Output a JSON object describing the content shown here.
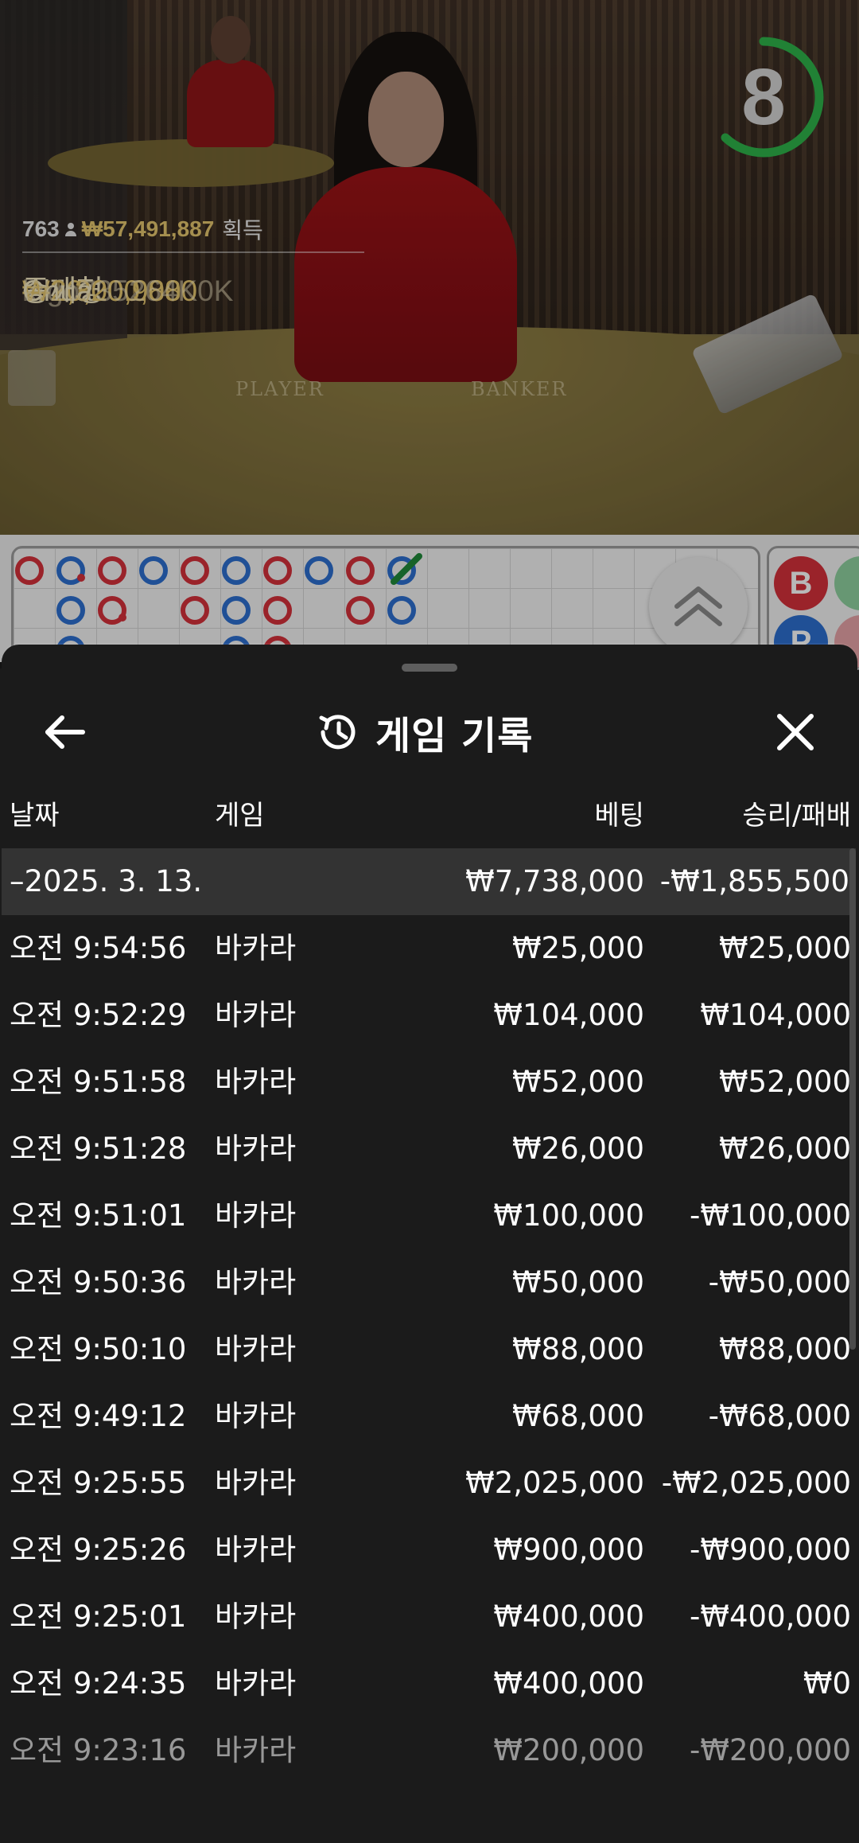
{
  "timer": {
    "value": "8",
    "progress": 0.62,
    "color": "#2fb34a"
  },
  "winners": {
    "player_count": "763",
    "total_amount": "₩57,491,887",
    "total_label": "획득",
    "list": [
      {
        "amount": "₩20,000,000",
        "name": "종깨형"
      },
      {
        "amount": "₩2,320,988",
        "name": "Chua"
      },
      {
        "amount": "₩1,600,000",
        "name": "krgo735264K0K"
      }
    ]
  },
  "table_labels": {
    "player": "PLAYER",
    "banker": "BANKER"
  },
  "side_road": {
    "chip1": "B",
    "chip2": "P"
  },
  "sheet": {
    "title": "게임 기록",
    "columns": {
      "date": "날짜",
      "game": "게임",
      "bet": "베팅",
      "result": "승리/패배"
    },
    "summary": {
      "date": "–2025. 3. 13.",
      "bet": "₩7,738,000",
      "result": "-₩1,855,500"
    },
    "rows": [
      {
        "time": "오전 9:54:56",
        "game": "바카라",
        "bet": "₩25,000",
        "result": "₩25,000"
      },
      {
        "time": "오전 9:52:29",
        "game": "바카라",
        "bet": "₩104,000",
        "result": "₩104,000"
      },
      {
        "time": "오전 9:51:58",
        "game": "바카라",
        "bet": "₩52,000",
        "result": "₩52,000"
      },
      {
        "time": "오전 9:51:28",
        "game": "바카라",
        "bet": "₩26,000",
        "result": "₩26,000"
      },
      {
        "time": "오전 9:51:01",
        "game": "바카라",
        "bet": "₩100,000",
        "result": "-₩100,000"
      },
      {
        "time": "오전 9:50:36",
        "game": "바카라",
        "bet": "₩50,000",
        "result": "-₩50,000"
      },
      {
        "time": "오전 9:50:10",
        "game": "바카라",
        "bet": "₩88,000",
        "result": "₩88,000"
      },
      {
        "time": "오전 9:49:12",
        "game": "바카라",
        "bet": "₩68,000",
        "result": "-₩68,000"
      },
      {
        "time": "오전 9:25:55",
        "game": "바카라",
        "bet": "₩2,025,000",
        "result": "-₩2,025,000"
      },
      {
        "time": "오전 9:25:26",
        "game": "바카라",
        "bet": "₩900,000",
        "result": "-₩900,000"
      },
      {
        "time": "오전 9:25:01",
        "game": "바카라",
        "bet": "₩400,000",
        "result": "-₩400,000"
      },
      {
        "time": "오전 9:24:35",
        "game": "바카라",
        "bet": "₩400,000",
        "result": "₩0"
      },
      {
        "time": "오전 9:23:16",
        "game": "바카라",
        "bet": "₩200,000",
        "result": "-₩200,000"
      }
    ]
  }
}
